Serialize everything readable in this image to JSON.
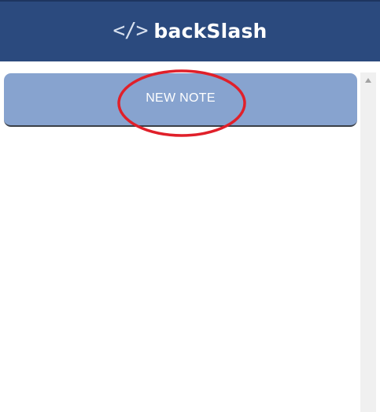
{
  "header": {
    "logo_icon": "</>",
    "logo_icon_name": "code-brackets-icon",
    "title": "backSlash",
    "background_color": "#2b4a7e"
  },
  "main": {
    "new_note_label": "NEW NOTE",
    "button_color": "#87a3cf"
  },
  "annotation": {
    "type": "ellipse",
    "color": "#e0202a",
    "target": "new-note-button"
  },
  "scrollbar": {
    "up_arrow_icon": "triangle-up-icon"
  }
}
